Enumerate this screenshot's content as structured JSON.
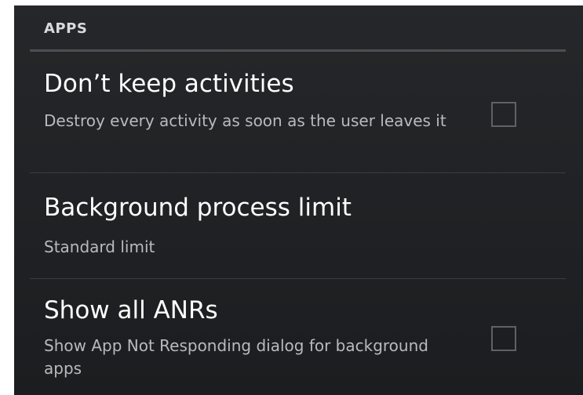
{
  "section": {
    "header": "APPS"
  },
  "prefs": [
    {
      "title": "Don’t keep activities",
      "summary": "Destroy every activity as soon as the user leaves it",
      "checked": false
    },
    {
      "title": "Background process limit",
      "summary": "Standard limit"
    },
    {
      "title": "Show all ANRs",
      "summary": "Show App Not Responding dialog for background apps",
      "checked": false
    }
  ]
}
